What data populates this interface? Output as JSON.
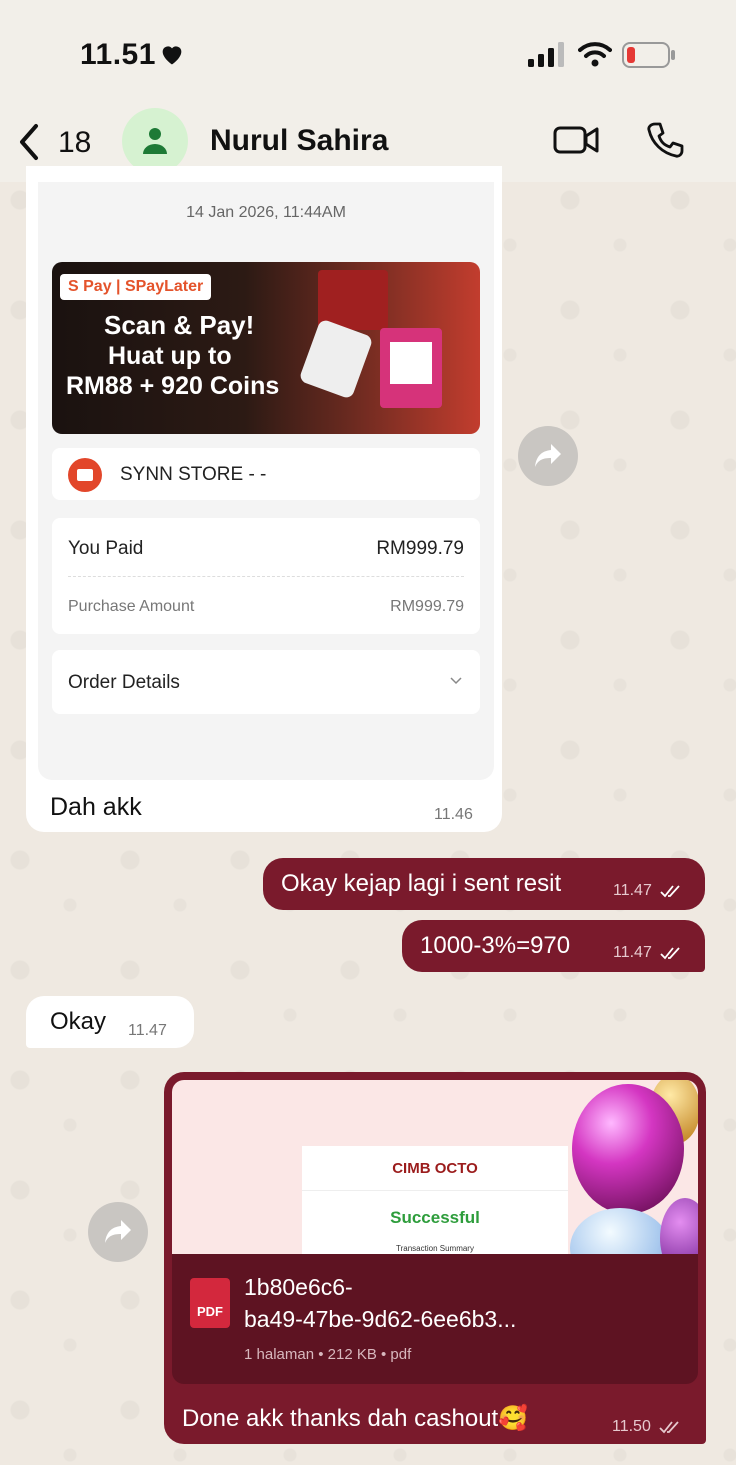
{
  "status_bar": {
    "time": "11.51"
  },
  "header": {
    "back_count": "18",
    "contact_name": "Nurul Sahira"
  },
  "messages": {
    "shared_card": {
      "date": "14 Jan 2026, 11:44AM",
      "banner": {
        "logo": "S Pay | SPayLater",
        "line1": "Scan & Pay!",
        "line2": "Huat up to",
        "line3": "RM88 + 920 Coins"
      },
      "store_name": "SYNN STORE - -",
      "you_paid_label": "You Paid",
      "you_paid_value": "RM999.79",
      "purchase_label": "Purchase Amount",
      "purchase_value": "RM999.79",
      "order_details_label": "Order Details"
    },
    "m1": {
      "text": "Dah akk",
      "time": "11.46"
    },
    "m2": {
      "text": "Okay kejap lagi i sent resit",
      "time": "11.47"
    },
    "m3": {
      "text": "1000-3%=970",
      "time": "11.47"
    },
    "m4": {
      "text": "Okay",
      "time": "11.47"
    },
    "m5": {
      "receipt_logo": "CIMB OCTO",
      "receipt_status": "Successful",
      "receipt_summary": "Transaction Summary",
      "file_name_line1": "1b80e6c6-",
      "file_name_line2": "ba49-47be-9d62-6ee6b3...",
      "file_meta": "1 halaman • 212 KB • pdf",
      "pdf_badge": "PDF",
      "text": "Done akk thanks dah cashout🥰",
      "time": "11.50"
    }
  },
  "colors": {
    "outgoing_bubble": "#7a1a2c",
    "incoming_bubble": "#ffffff",
    "read_check": "#ffffff"
  }
}
